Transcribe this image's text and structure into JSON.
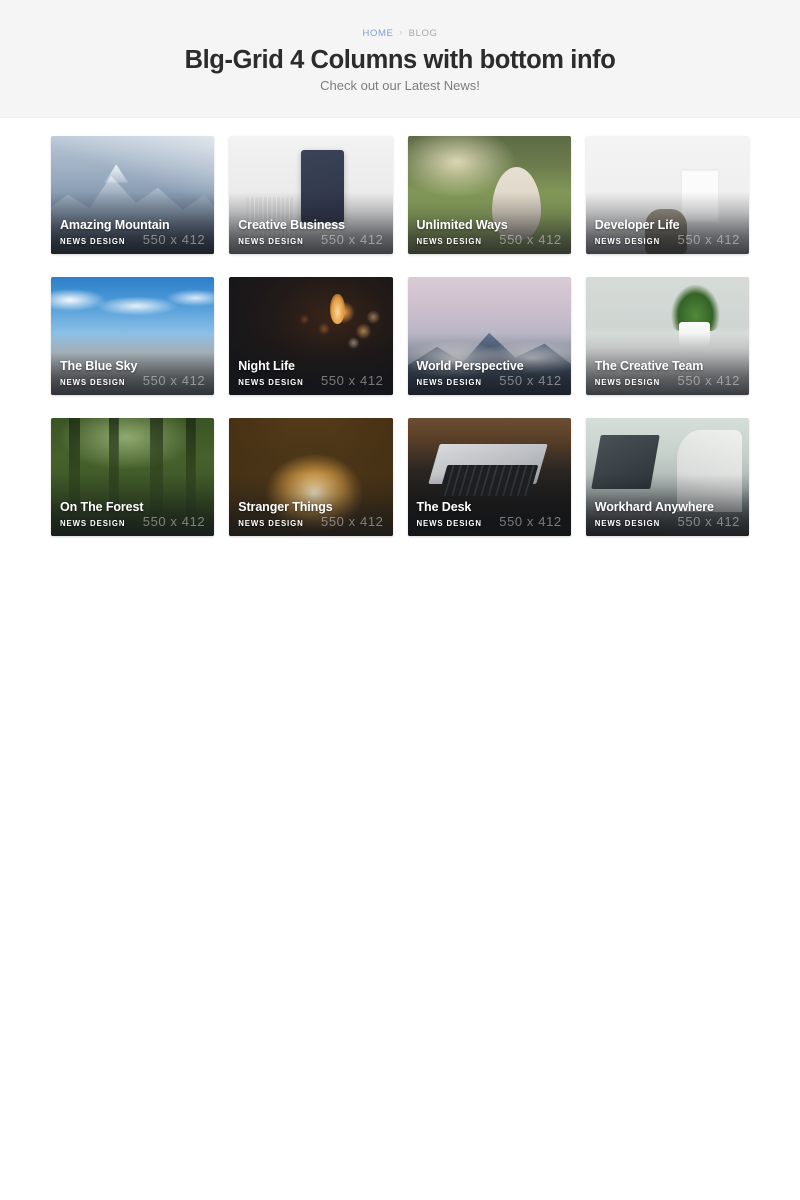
{
  "header": {
    "breadcrumb": {
      "home_label": "HOME",
      "separator": "›",
      "current_label": "BLOG"
    },
    "title": "Blg-Grid 4 Columns with bottom info",
    "subtitle": "Check out our Latest News!"
  },
  "grid": {
    "placeholder_text": "550 x 412",
    "cards": [
      {
        "title": "Amazing Mountain",
        "category": "NEWS DESIGN",
        "placeholder": "550 x 412",
        "photo": "ph-mountain"
      },
      {
        "title": "Creative Business",
        "category": "NEWS DESIGN",
        "placeholder": "550 x 412",
        "photo": "ph-desk-flat"
      },
      {
        "title": "Unlimited Ways",
        "category": "NEWS DESIGN",
        "placeholder": "550 x 412",
        "photo": "ph-field"
      },
      {
        "title": "Developer Life",
        "category": "NEWS DESIGN",
        "placeholder": "550 x 412",
        "photo": "ph-room"
      },
      {
        "title": "The Blue Sky",
        "category": "NEWS DESIGN",
        "placeholder": "550 x 412",
        "photo": "ph-sky"
      },
      {
        "title": "Night Life",
        "category": "NEWS DESIGN",
        "placeholder": "550 x 412",
        "photo": "ph-bokeh"
      },
      {
        "title": "World Perspective",
        "category": "NEWS DESIGN",
        "placeholder": "550 x 412",
        "photo": "ph-peak"
      },
      {
        "title": "The Creative Team",
        "category": "NEWS DESIGN",
        "placeholder": "550 x 412",
        "photo": "ph-plant"
      },
      {
        "title": "On The Forest",
        "category": "NEWS DESIGN",
        "placeholder": "550 x 412",
        "photo": "ph-forest"
      },
      {
        "title": "Stranger Things",
        "category": "NEWS DESIGN",
        "placeholder": "550 x 412",
        "photo": "ph-tunnel"
      },
      {
        "title": "The Desk",
        "category": "NEWS DESIGN",
        "placeholder": "550 x 412",
        "photo": "ph-laptop"
      },
      {
        "title": "Workhard Anywhere",
        "category": "NEWS DESIGN",
        "placeholder": "550 x 412",
        "photo": "ph-meeting"
      }
    ]
  },
  "colors": {
    "header_band": "#f5f5f6",
    "page_background": "#ffffff",
    "title_text": "#2c2c2c",
    "subtitle_text": "#7d7d7d",
    "breadcrumb_link": "#7d9fd4",
    "breadcrumb_current": "#a8a8a8",
    "card_title_text": "#ffffff"
  }
}
